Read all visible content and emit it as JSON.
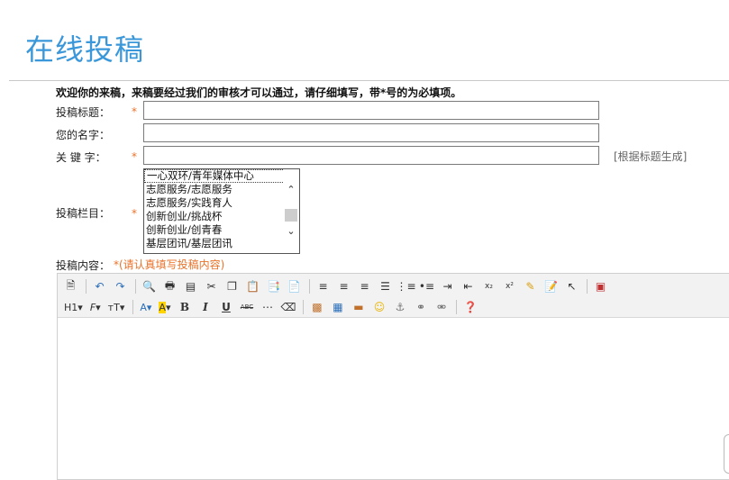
{
  "page": {
    "title": "在线投稿",
    "intro": "欢迎你的来稿，来稿要经过我们的审核才可以通过，请仔细填写，带*号的为必填项。"
  },
  "form": {
    "required_mark": "*",
    "title_label": "投稿标题：",
    "title_value": "",
    "name_label": "您的名字：",
    "name_value": "",
    "keywords_label": "关 键 字：",
    "keywords_value": "",
    "keywords_hint": "[根据标题生成]",
    "column_label": "投稿栏目：",
    "column_options": [
      "一心双环/青年媒体中心",
      "志愿服务/志愿服务",
      "志愿服务/实践育人",
      "创新创业/挑战杯",
      "创新创业/创青春",
      "基层团讯/基层团讯"
    ],
    "content_label": "投稿内容：",
    "content_note": "*(请认真填写投稿内容)"
  },
  "editor": {
    "font_size_label": "H1",
    "font_family_label": "F",
    "line_height_label": "тT",
    "font_color_label": "A",
    "bg_color_label": "A",
    "bold_label": "B",
    "italic_label": "I",
    "underline_label": "U",
    "strike_label": "ABC",
    "accent_color": "#3a97d9",
    "required_color": "#e8732a"
  }
}
